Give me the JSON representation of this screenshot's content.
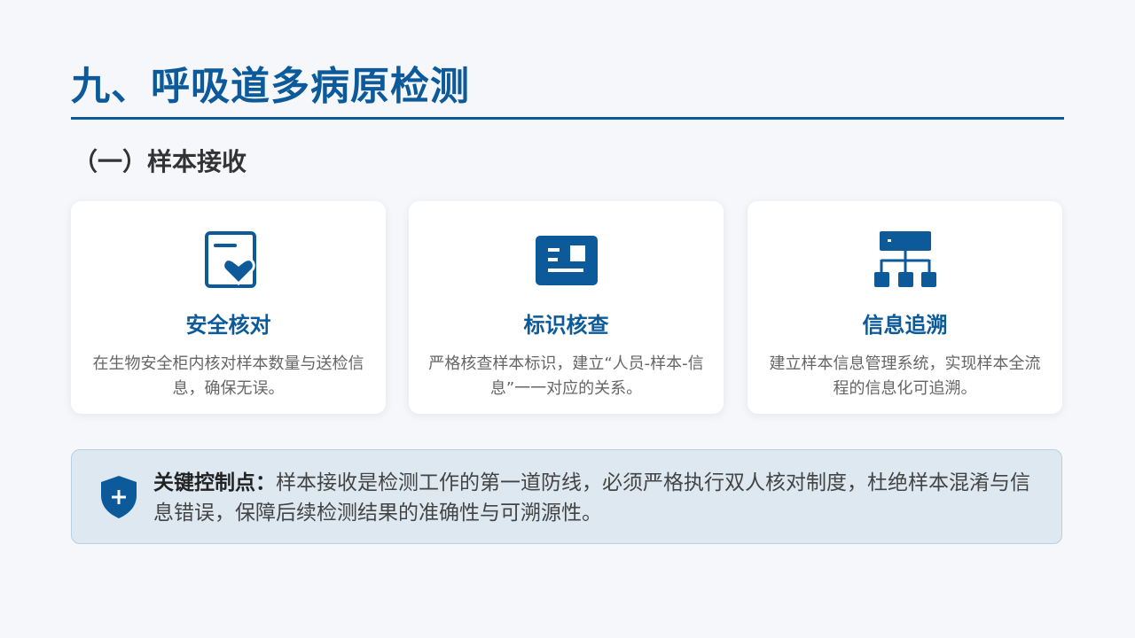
{
  "title": "九、呼吸道多病原检测",
  "subtitle": "（一）样本接收",
  "cards": [
    {
      "icon": "document-heart-icon",
      "title": "安全核对",
      "description": "在生物安全柜内核对样本数量与送检信息，确保无误。"
    },
    {
      "icon": "id-card-icon",
      "title": "标识核查",
      "description": "严格核查样本标识，建立“人员-样本-信息”一一对应的关系。"
    },
    {
      "icon": "network-hierarchy-icon",
      "title": "信息追溯",
      "description": "建立样本信息管理系统，实现样本全流程的信息化可追溯。"
    }
  ],
  "callout": {
    "icon": "shield-plus-icon",
    "label": "关键控制点：",
    "text": "样本接收是检测工作的第一道防线，必须严格执行双人核对制度，杜绝样本混淆与信息错误，保障后续检测结果的准确性与可溯源性。"
  },
  "colors": {
    "primary": "#0d5a9a",
    "background": "#f5f7fa",
    "card": "#ffffff",
    "callout_background": "#dde8f1"
  }
}
